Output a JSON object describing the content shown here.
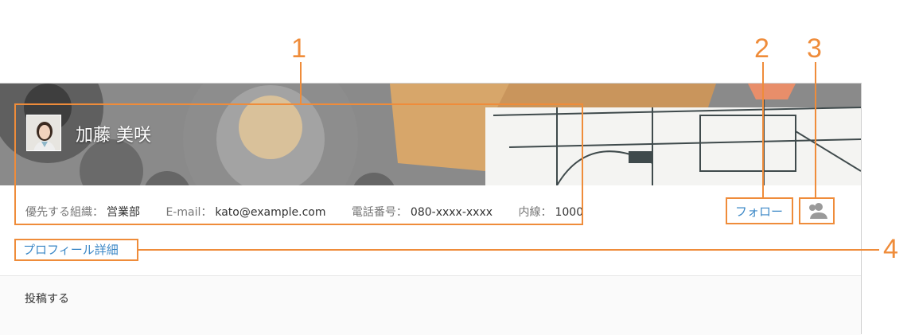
{
  "callouts": [
    "1",
    "2",
    "3",
    "4"
  ],
  "profile": {
    "name": "加藤 美咲",
    "info": [
      {
        "label": "優先する組織：",
        "value": "営業部"
      },
      {
        "label": "E-mail：",
        "value": "kato@example.com"
      },
      {
        "label": "電話番号：",
        "value": "080-xxxx-xxxx"
      },
      {
        "label": "内線：",
        "value": "1000"
      }
    ]
  },
  "actions": {
    "follow_label": "フォロー",
    "person_icon": "person-icon",
    "profile_detail_label": "プロフィール詳細"
  },
  "post": {
    "label": "投稿する"
  },
  "colors": {
    "callout": "#ef8c3a",
    "link": "#3a87c6"
  }
}
